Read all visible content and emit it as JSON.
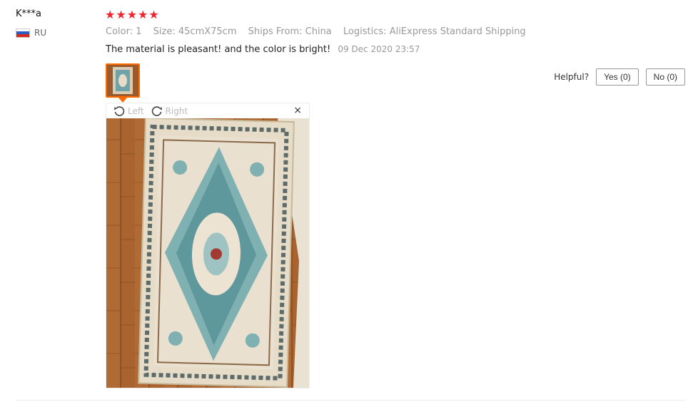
{
  "reviewer": {
    "name": "K***a",
    "country": "RU"
  },
  "rating": {
    "stars": 5,
    "max": 5,
    "glyph": "★"
  },
  "attributes": [
    {
      "key": "Color:",
      "value": "1"
    },
    {
      "key": "Size:",
      "value": "45cmX75cm"
    },
    {
      "key": "Ships From:",
      "value": "China"
    },
    {
      "key": "Logistics:",
      "value": "AliExpress Standard Shipping"
    }
  ],
  "review": {
    "text": "The material is pleasant! and the color is bright!",
    "date": "09 Dec 2020 23:57"
  },
  "helpful": {
    "label": "Helpful?",
    "yes": "Yes (0)",
    "no": "No (0)"
  },
  "viewer": {
    "rotate_left": "Left",
    "rotate_right": "Right",
    "close": "×"
  },
  "colors": {
    "star": "#f5222d",
    "accent": "#ff6a00",
    "muted": "#999999"
  },
  "icons": {
    "rotate_left": "rotate-left-icon",
    "rotate_right": "rotate-right-icon",
    "close": "close-icon"
  }
}
